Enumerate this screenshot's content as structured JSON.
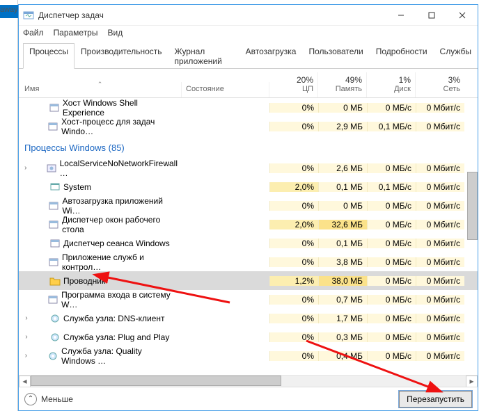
{
  "outer_tab_fragment": "away",
  "window": {
    "title": "Диспетчер задач"
  },
  "menu": {
    "file": "Файл",
    "options": "Параметры",
    "view": "Вид"
  },
  "tabs": {
    "processes": "Процессы",
    "performance": "Производительность",
    "app_history": "Журнал приложений",
    "startup": "Автозагрузка",
    "users": "Пользователи",
    "details": "Подробности",
    "services": "Службы"
  },
  "columns": {
    "name": "Имя",
    "state": "Состояние",
    "cpu": {
      "pct": "20%",
      "label": "ЦП"
    },
    "mem": {
      "pct": "49%",
      "label": "Память"
    },
    "disk": {
      "pct": "1%",
      "label": "Диск"
    },
    "net": {
      "pct": "3%",
      "label": "Сеть"
    }
  },
  "group_label": "Процессы Windows (85)",
  "rows": [
    {
      "expand": "",
      "icon": "app",
      "name": "Хост Windows Shell Experience",
      "cpu": "0%",
      "mem": "0 МБ",
      "disk": "0 МБ/c",
      "net": "0 Мбит/с",
      "cpu_cls": "",
      "mem_cls": "",
      "disk_cls": "",
      "indent": 1
    },
    {
      "expand": "",
      "icon": "app",
      "name": "Хост-процесс для задач Windo…",
      "cpu": "0%",
      "mem": "2,9 МБ",
      "disk": "0,1 МБ/c",
      "net": "0 Мбит/с",
      "cpu_cls": "",
      "mem_cls": "",
      "disk_cls": "",
      "indent": 1
    },
    {
      "group": true
    },
    {
      "expand": "›",
      "icon": "svc",
      "name": "LocalServiceNoNetworkFirewall …",
      "cpu": "0%",
      "mem": "2,6 МБ",
      "disk": "0 МБ/c",
      "net": "0 Мбит/с",
      "cpu_cls": "",
      "mem_cls": "",
      "disk_cls": "",
      "indent": 1
    },
    {
      "expand": "",
      "icon": "sys",
      "name": "System",
      "cpu": "2,0%",
      "mem": "0,1 МБ",
      "disk": "0,1 МБ/c",
      "net": "0 Мбит/с",
      "cpu_cls": "med",
      "mem_cls": "",
      "disk_cls": "",
      "indent": 1
    },
    {
      "expand": "",
      "icon": "app",
      "name": "Автозагрузка приложений Wi…",
      "cpu": "0%",
      "mem": "0 МБ",
      "disk": "0 МБ/c",
      "net": "0 Мбит/с",
      "cpu_cls": "",
      "mem_cls": "",
      "disk_cls": "",
      "indent": 1
    },
    {
      "expand": "",
      "icon": "app",
      "name": "Диспетчер окон рабочего стола",
      "cpu": "2,0%",
      "mem": "32,6 МБ",
      "disk": "0 МБ/c",
      "net": "0 Мбит/с",
      "cpu_cls": "med",
      "mem_cls": "hi",
      "disk_cls": "",
      "indent": 1
    },
    {
      "expand": "",
      "icon": "app",
      "name": "Диспетчер сеанса  Windows",
      "cpu": "0%",
      "mem": "0,1 МБ",
      "disk": "0 МБ/c",
      "net": "0 Мбит/с",
      "cpu_cls": "",
      "mem_cls": "",
      "disk_cls": "",
      "indent": 1
    },
    {
      "expand": "",
      "icon": "app",
      "name": "Приложение служб и контрол…",
      "cpu": "0%",
      "mem": "3,8 МБ",
      "disk": "0 МБ/c",
      "net": "0 Мбит/с",
      "cpu_cls": "",
      "mem_cls": "",
      "disk_cls": "",
      "indent": 1
    },
    {
      "expand": "",
      "icon": "folder",
      "name": "Проводник",
      "cpu": "1,2%",
      "mem": "38,0 МБ",
      "disk": "0 МБ/c",
      "net": "0 Мбит/с",
      "cpu_cls": "med",
      "mem_cls": "hi",
      "disk_cls": "",
      "indent": 1,
      "selected": true
    },
    {
      "expand": "",
      "icon": "app",
      "name": "Программа входа в систему W…",
      "cpu": "0%",
      "mem": "0,7 МБ",
      "disk": "0 МБ/c",
      "net": "0 Мбит/с",
      "cpu_cls": "",
      "mem_cls": "",
      "disk_cls": "",
      "indent": 1
    },
    {
      "expand": "›",
      "icon": "gear",
      "name": "Служба узла: DNS-клиент",
      "cpu": "0%",
      "mem": "1,7 МБ",
      "disk": "0 МБ/c",
      "net": "0 Мбит/с",
      "cpu_cls": "",
      "mem_cls": "",
      "disk_cls": "",
      "indent": 1
    },
    {
      "expand": "›",
      "icon": "gear",
      "name": "Служба узла: Plug and Play",
      "cpu": "0%",
      "mem": "0,3 МБ",
      "disk": "0 МБ/c",
      "net": "0 Мбит/с",
      "cpu_cls": "",
      "mem_cls": "",
      "disk_cls": "",
      "indent": 1
    },
    {
      "expand": "›",
      "icon": "gear",
      "name": "Служба узла: Quality Windows …",
      "cpu": "0%",
      "mem": "0,4 МБ",
      "disk": "0 МБ/c",
      "net": "0 Мбит/с",
      "cpu_cls": "",
      "mem_cls": "",
      "disk_cls": "",
      "indent": 1
    }
  ],
  "footer": {
    "fewer": "Меньше",
    "restart": "Перезапустить"
  }
}
